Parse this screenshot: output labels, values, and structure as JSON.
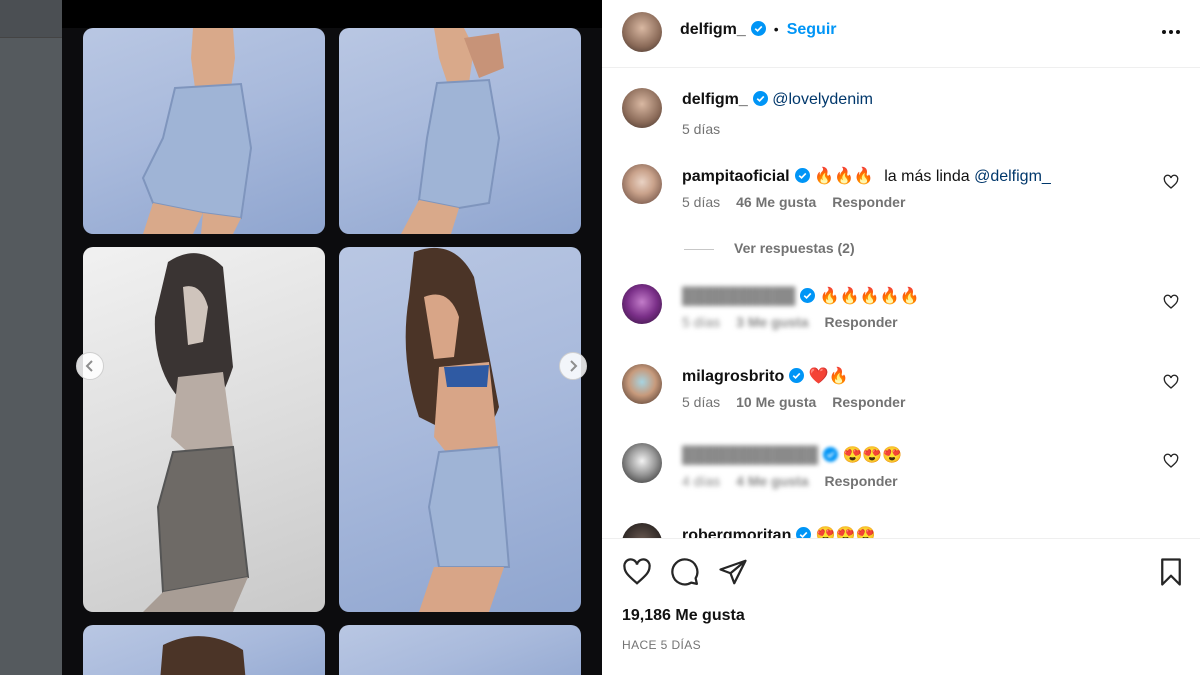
{
  "header": {
    "username": "delfigm_",
    "follow_label": "Seguir",
    "separator": "•"
  },
  "caption": {
    "username": "delfigm_",
    "mention": "@lovelydenim",
    "time": "5 días"
  },
  "comments": [
    {
      "username": "pampitaoficial",
      "verified": true,
      "emojis": "🔥🔥🔥",
      "text": "la más linda",
      "mention": "@delfigm_",
      "time": "5 días",
      "likes": "46 Me gusta",
      "reply_label": "Responder"
    },
    {
      "username": "██████████",
      "blurred": true,
      "verified": true,
      "emojis": "🔥🔥🔥🔥🔥",
      "time": "5 días",
      "likes": "3 Me gusta",
      "reply_label": "Responder"
    },
    {
      "username": "milagrosbrito",
      "verified": true,
      "emojis": "❤️🔥",
      "time": "5 días",
      "likes": "10 Me gusta",
      "reply_label": "Responder"
    },
    {
      "username": "████████████",
      "blurred": true,
      "verified": true,
      "emojis": "😍😍😍",
      "time": "4 días",
      "likes": "4 Me gusta",
      "reply_label": "Responder"
    },
    {
      "username": "robergmoritan",
      "verified": true,
      "emojis": "😍😍😍"
    }
  ],
  "view_replies_label": "Ver respuestas (2)",
  "actions": {
    "like_icon": "heart-icon",
    "comment_icon": "comment-icon",
    "share_icon": "share-icon",
    "save_icon": "bookmark-icon"
  },
  "likes_count": "19,186 Me gusta",
  "posted_ago": "HACE 5 DÍAS",
  "colors": {
    "accent": "#0095f6",
    "verified": "#0095f6",
    "mention": "#00376b",
    "muted": "#737373"
  }
}
